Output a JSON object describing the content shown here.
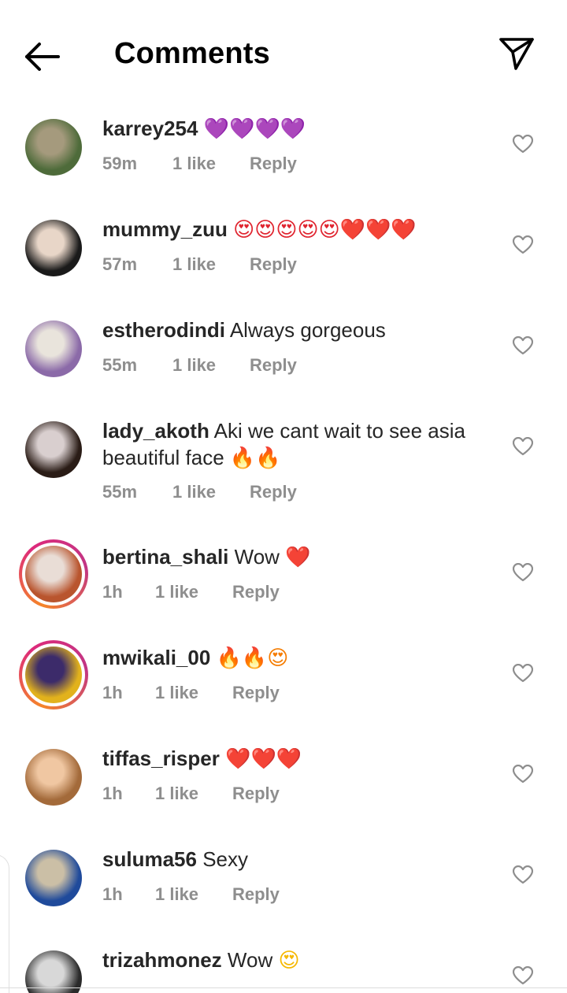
{
  "header": {
    "back_icon": "arrow-left-icon",
    "title": "Comments",
    "share_icon": "paper-plane-icon"
  },
  "reply_label": "Reply",
  "comments": [
    {
      "username": "karrey254",
      "text": "",
      "emoji": "💜💜💜💜",
      "time": "59m",
      "likes": "1 like",
      "avatar_colors": [
        "#4e6b3a",
        "#a59a7d"
      ],
      "ring": false
    },
    {
      "username": "mummy_zuu",
      "text": "",
      "emoji": "😍😍😍😍😍❤️❤️❤️",
      "time": "57m",
      "likes": "1 like",
      "avatar_colors": [
        "#1a1a1a",
        "#e8d6c8"
      ],
      "ring": false
    },
    {
      "username": "estherodindi",
      "text": "Always gorgeous",
      "emoji": "",
      "time": "55m",
      "likes": "1 like",
      "avatar_colors": [
        "#8b6aa8",
        "#e9e4dc"
      ],
      "ring": false
    },
    {
      "username": "lady_akoth",
      "text": "Aki we cant wait to see asia beautiful  face",
      "emoji": "🔥🔥",
      "time": "55m",
      "likes": "1 like",
      "avatar_colors": [
        "#2a1c16",
        "#d9cfcf"
      ],
      "ring": false
    },
    {
      "username": "bertina_shali",
      "text": "Wow",
      "emoji": "❤️",
      "time": "1h",
      "likes": "1 like",
      "avatar_colors": [
        "#b9552e",
        "#e9ddd6"
      ],
      "ring": true
    },
    {
      "username": "mwikali_00",
      "text": "",
      "emoji": "🔥🔥😍",
      "time": "1h",
      "likes": "1 like",
      "avatar_colors": [
        "#e2b21c",
        "#3c2b6a"
      ],
      "ring": true
    },
    {
      "username": "tiffas_risper",
      "text": "",
      "emoji": "❤️❤️❤️",
      "time": "1h",
      "likes": "1 like",
      "avatar_colors": [
        "#a36a3a",
        "#f0c7a2"
      ],
      "ring": false
    },
    {
      "username": "suluma56",
      "text": "Sexy",
      "emoji": "",
      "time": "1h",
      "likes": "1 like",
      "avatar_colors": [
        "#1f4a9b",
        "#cbbfa6"
      ],
      "ring": false
    },
    {
      "username": "trizahmonez",
      "text": "Wow",
      "emoji": "😍",
      "time": "",
      "likes": "",
      "avatar_colors": [
        "#2a2a2a",
        "#d8d8d8"
      ],
      "ring": false
    }
  ]
}
